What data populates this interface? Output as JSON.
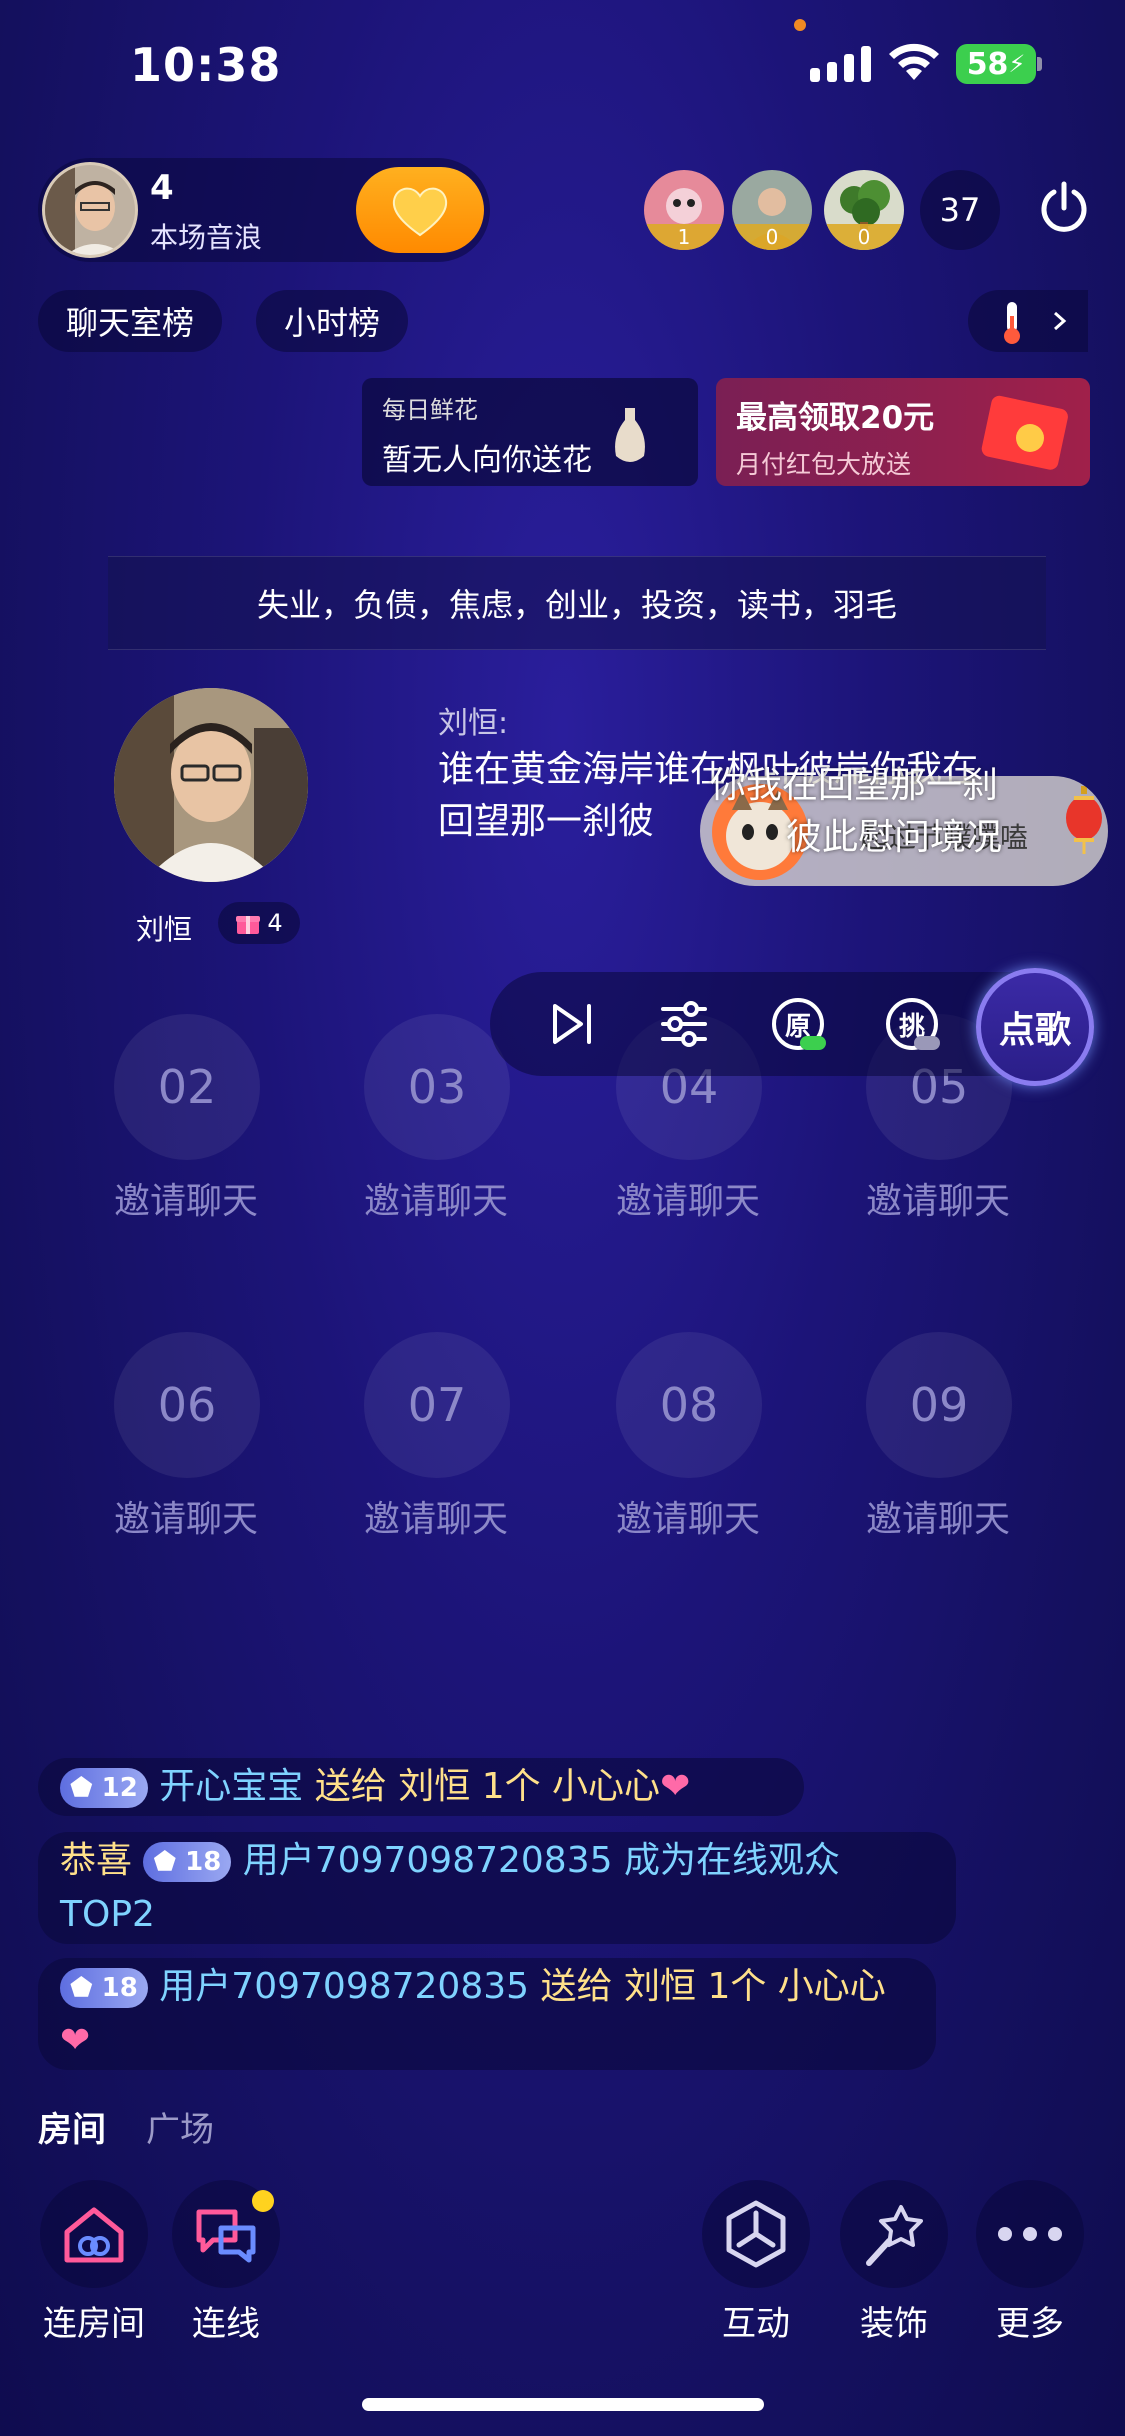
{
  "status_bar": {
    "time": "10:38",
    "battery": "58"
  },
  "host": {
    "sound_wave_count": "4",
    "sound_wave_label": "本场音浪"
  },
  "viewers": [
    {
      "badge": "1"
    },
    {
      "badge": "0"
    },
    {
      "badge": "0"
    }
  ],
  "viewer_count": "37",
  "rank_chips": [
    "聊天室榜",
    "小时榜"
  ],
  "flower_card": {
    "title": "每日鲜花",
    "text": "暂无人向你送花"
  },
  "red_packet_card": {
    "title": "最高领取20元",
    "subtitle": "月付红包大放送"
  },
  "topic": "失业，负债，焦虑，创业，投资，读书，羽毛",
  "singer": {
    "name": "刘恒",
    "gift_count": "4"
  },
  "lyric": {
    "speaker": "刘恒:",
    "text": "谁在黄金海岸谁在枫叶彼岸你我在回望那一刹彼"
  },
  "pendant": {
    "text": "你我在回望那一刹\n彼此慰问境况",
    "sub": "起过节噗噗嗑"
  },
  "controls": {
    "original_label": "原",
    "pick_label": "挑",
    "order_song_label": "点歌"
  },
  "seats": [
    {
      "number": "02",
      "label": "邀请聊天"
    },
    {
      "number": "03",
      "label": "邀请聊天"
    },
    {
      "number": "04",
      "label": "邀请聊天"
    },
    {
      "number": "05",
      "label": "邀请聊天"
    },
    {
      "number": "06",
      "label": "邀请聊天"
    },
    {
      "number": "07",
      "label": "邀请聊天"
    },
    {
      "number": "08",
      "label": "邀请聊天"
    },
    {
      "number": "09",
      "label": "邀请聊天"
    }
  ],
  "messages": [
    {
      "level": "12",
      "user": "开心宝宝",
      "action": "送给",
      "target": "刘恒",
      "gift": "1个 小心心"
    },
    {
      "prefix": "恭喜",
      "level": "18",
      "user": "用户7097098720835",
      "text": "成为在线观众TOP2"
    },
    {
      "level": "18",
      "user": "用户7097098720835",
      "action": "送给",
      "target": "刘恒",
      "gift": "1个 小心心"
    }
  ],
  "tabs": [
    "房间",
    "广场"
  ],
  "bottom_actions": [
    {
      "label": "连房间"
    },
    {
      "label": "连线"
    },
    {
      "label": "互动"
    },
    {
      "label": "装饰"
    },
    {
      "label": "更多"
    }
  ],
  "colors": {
    "accent_orange": "#ff9a0e",
    "level_badge": "#7b8ae8",
    "name_blue": "#7fd3ff",
    "gift_gold": "#ffe08a"
  }
}
